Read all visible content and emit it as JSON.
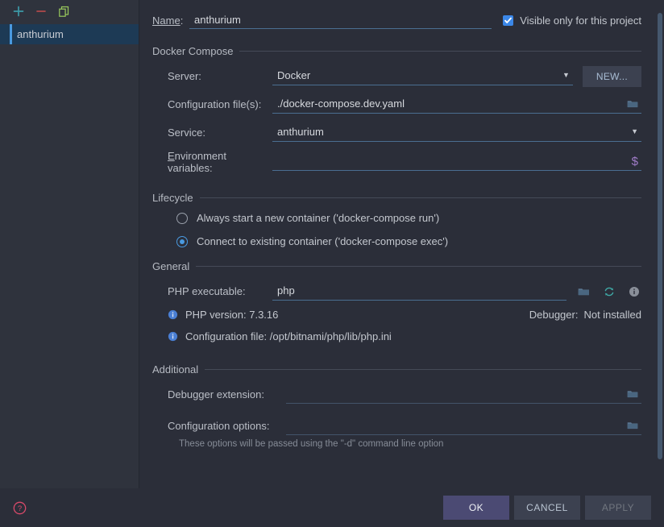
{
  "sidebar": {
    "toolbar": [
      {
        "name": "add-button",
        "icon": "plus-icon",
        "color": "#3d9aa8"
      },
      {
        "name": "remove-button",
        "icon": "minus-icon",
        "color": "#b04a4a"
      },
      {
        "name": "copy-button",
        "icon": "copy-icon",
        "color": "#9aca5c"
      }
    ],
    "items": [
      {
        "label": "anthurium",
        "selected": true
      }
    ]
  },
  "header": {
    "name_label": "Name:",
    "name_value": "anthurium",
    "visible_checkbox_label": "Visible only for this project",
    "visible_checkbox_checked": true
  },
  "docker_compose": {
    "title": "Docker Compose",
    "server_label": "Server:",
    "server_value": "Docker",
    "new_button": "NEW...",
    "config_files_label": "Configuration file(s):",
    "config_files_value": "./docker-compose.dev.yaml",
    "service_label": "Service:",
    "service_value": "anthurium",
    "env_vars_label": "Environment variables:",
    "env_vars_value": "",
    "env_vars_icon": "dollar-macro-icon",
    "browse_icon": "folder-icon"
  },
  "lifecycle": {
    "title": "Lifecycle",
    "options": [
      {
        "label": "Always start a new container ('docker-compose run')",
        "selected": false
      },
      {
        "label": "Connect to existing container ('docker-compose exec')",
        "selected": true
      }
    ]
  },
  "general": {
    "title": "General",
    "php_executable_label": "PHP executable:",
    "php_executable_value": "php",
    "php_version_text": "PHP version: 7.3.16",
    "debugger_label": "Debugger:",
    "debugger_value": "Not installed",
    "configuration_file_text": "Configuration file: /opt/bitnami/php/lib/php.ini",
    "icons": [
      "folder-icon",
      "refresh-icon",
      "info-icon"
    ]
  },
  "additional": {
    "title": "Additional",
    "debugger_extension_label": "Debugger extension:",
    "debugger_extension_value": "",
    "configuration_options_label": "Configuration options:",
    "configuration_options_value": "",
    "hint": "These options will be passed using the \"-d\" command line option"
  },
  "footer": {
    "help_icon": "help-circle-icon",
    "ok_label": "OK",
    "cancel_label": "CANCEL",
    "apply_label": "APPLY",
    "apply_disabled": true
  },
  "colors": {
    "window_bg": "#2b2e39",
    "sidebar_bg": "#2f333d",
    "selection_bg": "#1d3a55",
    "accent_blue": "#4a9ae0",
    "checkbox_blue": "#3b87e8",
    "ok_button": "#4b4a73",
    "underline": "#4a6e91",
    "help_red": "#d94a6a"
  }
}
